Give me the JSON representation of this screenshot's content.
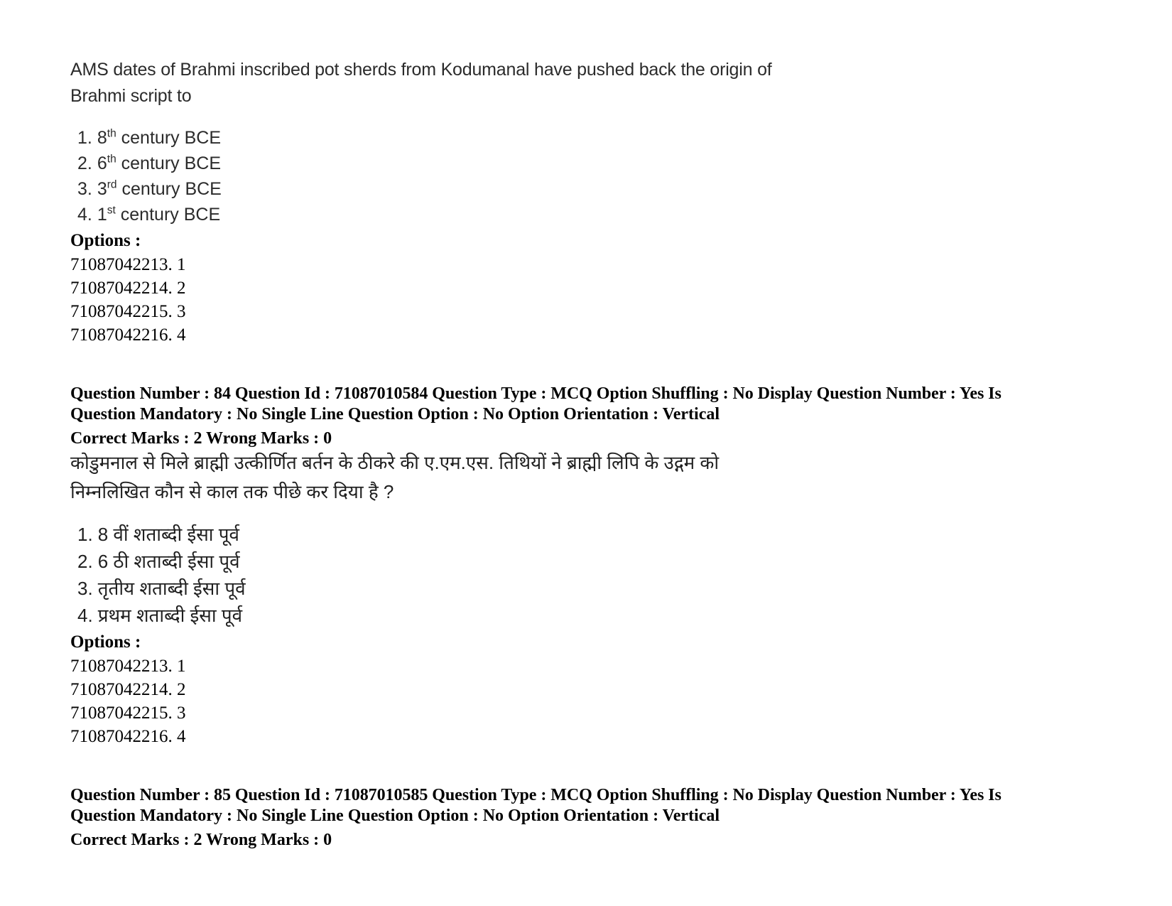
{
  "question_en": {
    "stem_line1": "AMS dates of Brahmi inscribed pot sherds from Kodumanal have pushed back the origin of",
    "stem_line2": "Brahmi script to",
    "choices": [
      {
        "marker": "1.",
        "value": "8",
        "ordinal": "th",
        "rest": "century BCE"
      },
      {
        "marker": "2.",
        "value": "6",
        "ordinal": "th",
        "rest": "century BCE"
      },
      {
        "marker": "3.",
        "value": "3",
        "ordinal": "rd",
        "rest": "century BCE"
      },
      {
        "marker": "4.",
        "value": "1",
        "ordinal": "st",
        "rest": "century BCE"
      }
    ],
    "options_label": "Options :",
    "option_ids": [
      "71087042213. 1",
      "71087042214. 2",
      "71087042215. 3",
      "71087042216. 4"
    ]
  },
  "meta_84": {
    "line1": "Question Number : 84 Question Id : 71087010584 Question Type : MCQ Option Shuffling : No Display Question Number : Yes Is",
    "line2": "Question Mandatory : No Single Line Question Option : No Option Orientation : Vertical",
    "marks": "Correct Marks : 2 Wrong Marks : 0"
  },
  "question_hi": {
    "stem_line1": "कोडुमनाल से मिले ब्राह्मी उत्कीर्णित बर्तन के ठीकरे की ए.एम.एस. तिथियों ने ब्राह्मी लिपि के उद्गम को",
    "stem_line2": "निम्नलिखित कौन से काल तक पीछे कर दिया है ?",
    "choices": [
      {
        "marker": "1.",
        "text": "8 वीं शताब्दी ईसा पूर्व"
      },
      {
        "marker": "2.",
        "text": "6 ठी शताब्दी ईसा पूर्व"
      },
      {
        "marker": "3.",
        "text": "तृतीय शताब्दी ईसा पूर्व"
      },
      {
        "marker": "4.",
        "text": "प्रथम शताब्दी ईसा पूर्व"
      }
    ],
    "options_label": "Options :",
    "option_ids": [
      "71087042213. 1",
      "71087042214. 2",
      "71087042215. 3",
      "71087042216. 4"
    ]
  },
  "meta_85": {
    "line1": "Question Number : 85 Question Id : 71087010585 Question Type : MCQ Option Shuffling : No Display Question Number : Yes Is",
    "line2": "Question Mandatory : No Single Line Question Option : No Option Orientation : Vertical",
    "marks": "Correct Marks : 2 Wrong Marks : 0"
  }
}
